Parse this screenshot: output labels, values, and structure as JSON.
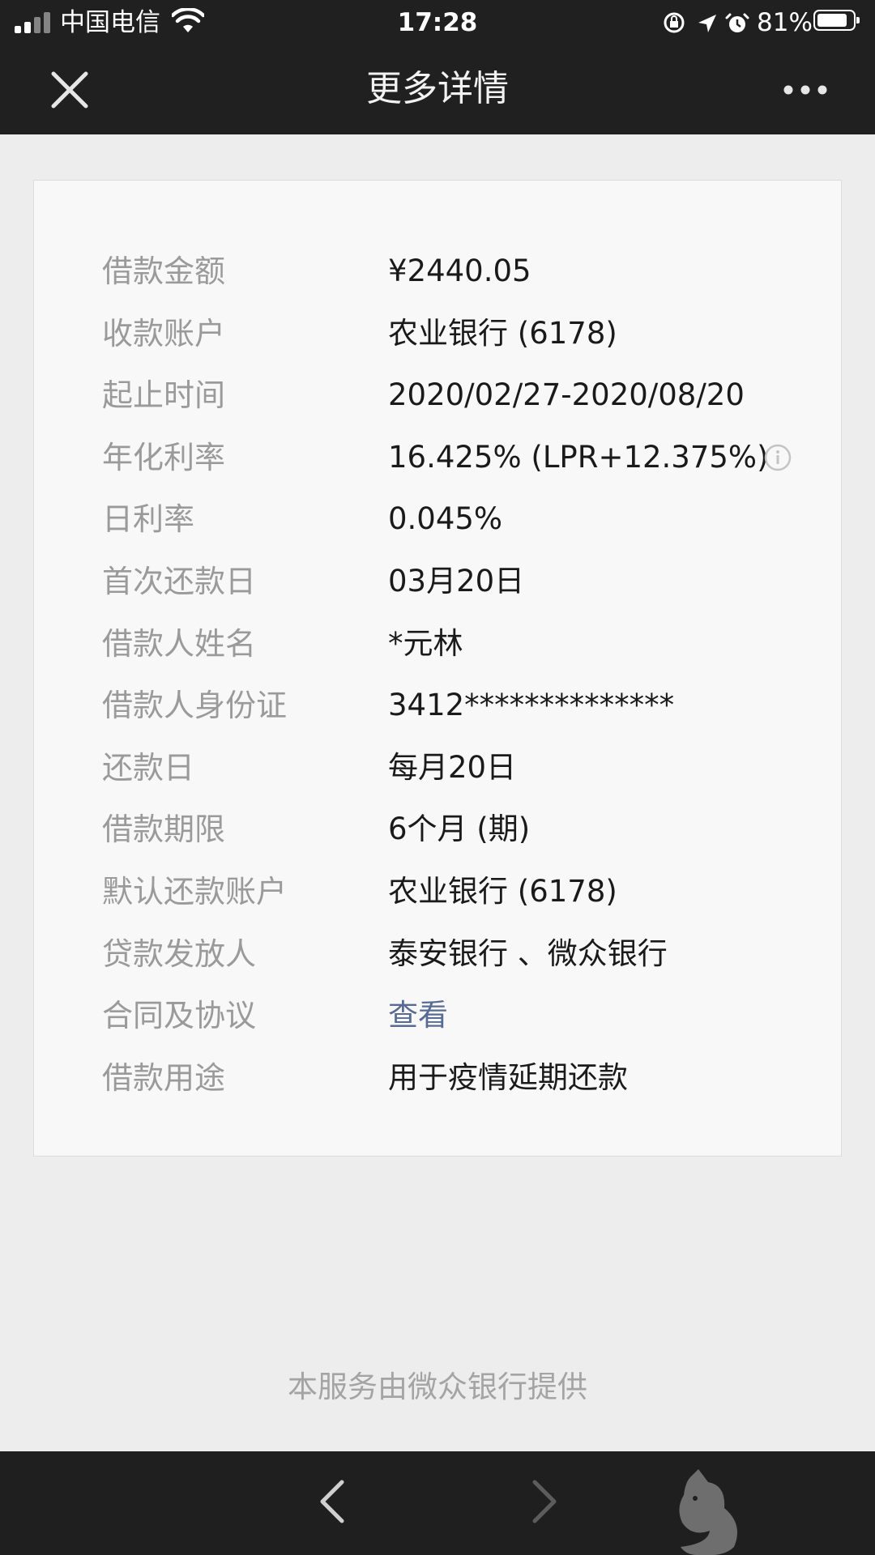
{
  "status_bar": {
    "carrier": "中国电信",
    "time": "17:28",
    "battery_percent": "81%",
    "battery_level": 0.81
  },
  "nav": {
    "title": "更多详情",
    "close_icon": "close-icon",
    "more_icon": "ellipsis-icon"
  },
  "details": [
    {
      "label": "借款金额",
      "value": "¥2440.05"
    },
    {
      "label": "收款账户",
      "value": "农业银行 (6178)"
    },
    {
      "label": "起止时间",
      "value": "2020/02/27-2020/08/20"
    },
    {
      "label": "年化利率",
      "value": "16.425% (LPR+12.375%)"
    },
    {
      "label": "日利率",
      "value": "0.045%"
    },
    {
      "label": "首次还款日",
      "value": "03月20日"
    },
    {
      "label": "借款人姓名",
      "value": "*元林"
    },
    {
      "label": "借款人身份证",
      "value": "3412**************"
    },
    {
      "label": "还款日",
      "value": "每月20日"
    },
    {
      "label": "借款期限",
      "value": "6个月 (期)"
    },
    {
      "label": "默认还款账户",
      "value": "农业银行 (6178)"
    },
    {
      "label": "贷款发放人",
      "value": "泰安银行 、微众银行"
    },
    {
      "label": "合同及协议",
      "value": "查看"
    },
    {
      "label": "借款用途",
      "value": "用于疫情延期还款"
    }
  ],
  "footer": {
    "provider_note": "本服务由微众银行提供"
  },
  "colors": {
    "background": "#ededed",
    "bar": "#202020",
    "label": "#9a9a9a",
    "value": "#1a1a1a",
    "link": "#576b95"
  }
}
